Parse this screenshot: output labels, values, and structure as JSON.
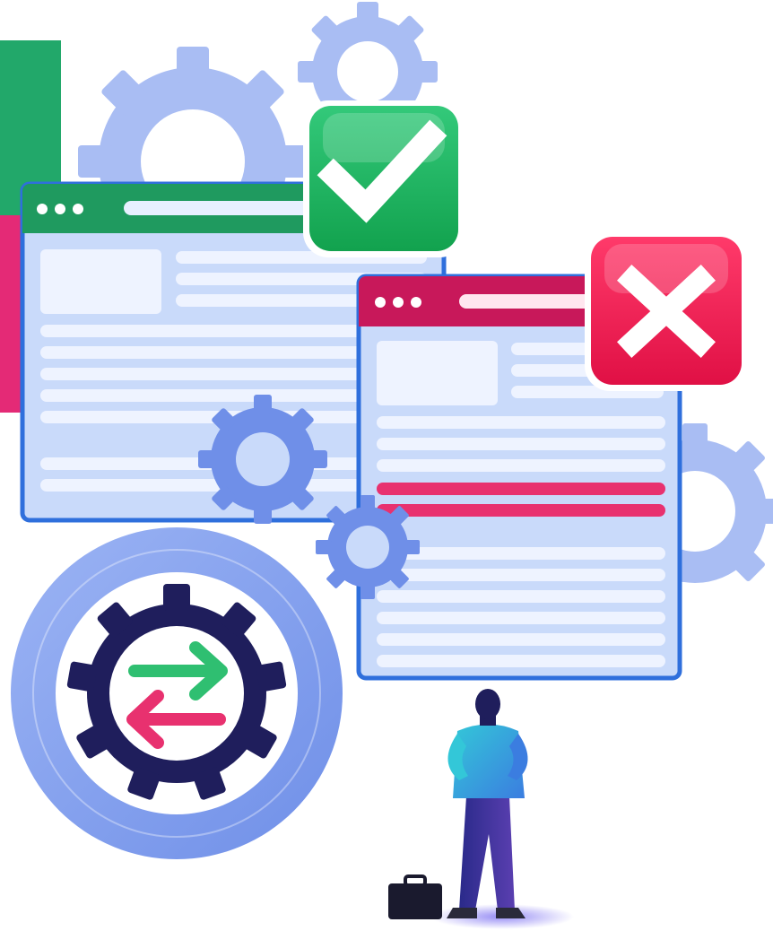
{
  "illustration": {
    "windows": [
      {
        "id": "approved",
        "header_color": "#1f9a5f",
        "status": "check-icon"
      },
      {
        "id": "rejected",
        "header_color": "#c8185a",
        "status": "cross-icon"
      }
    ],
    "center_icon": "exchange-arrows-gear-icon",
    "person": "person-with-briefcase",
    "colors": {
      "green": "#22b16a",
      "pink": "#e8316f",
      "blue": "#2f6fdc",
      "light_blue": "#bcd0f7",
      "gear": "#8aa6ef",
      "navy": "#1f1e5c"
    }
  }
}
